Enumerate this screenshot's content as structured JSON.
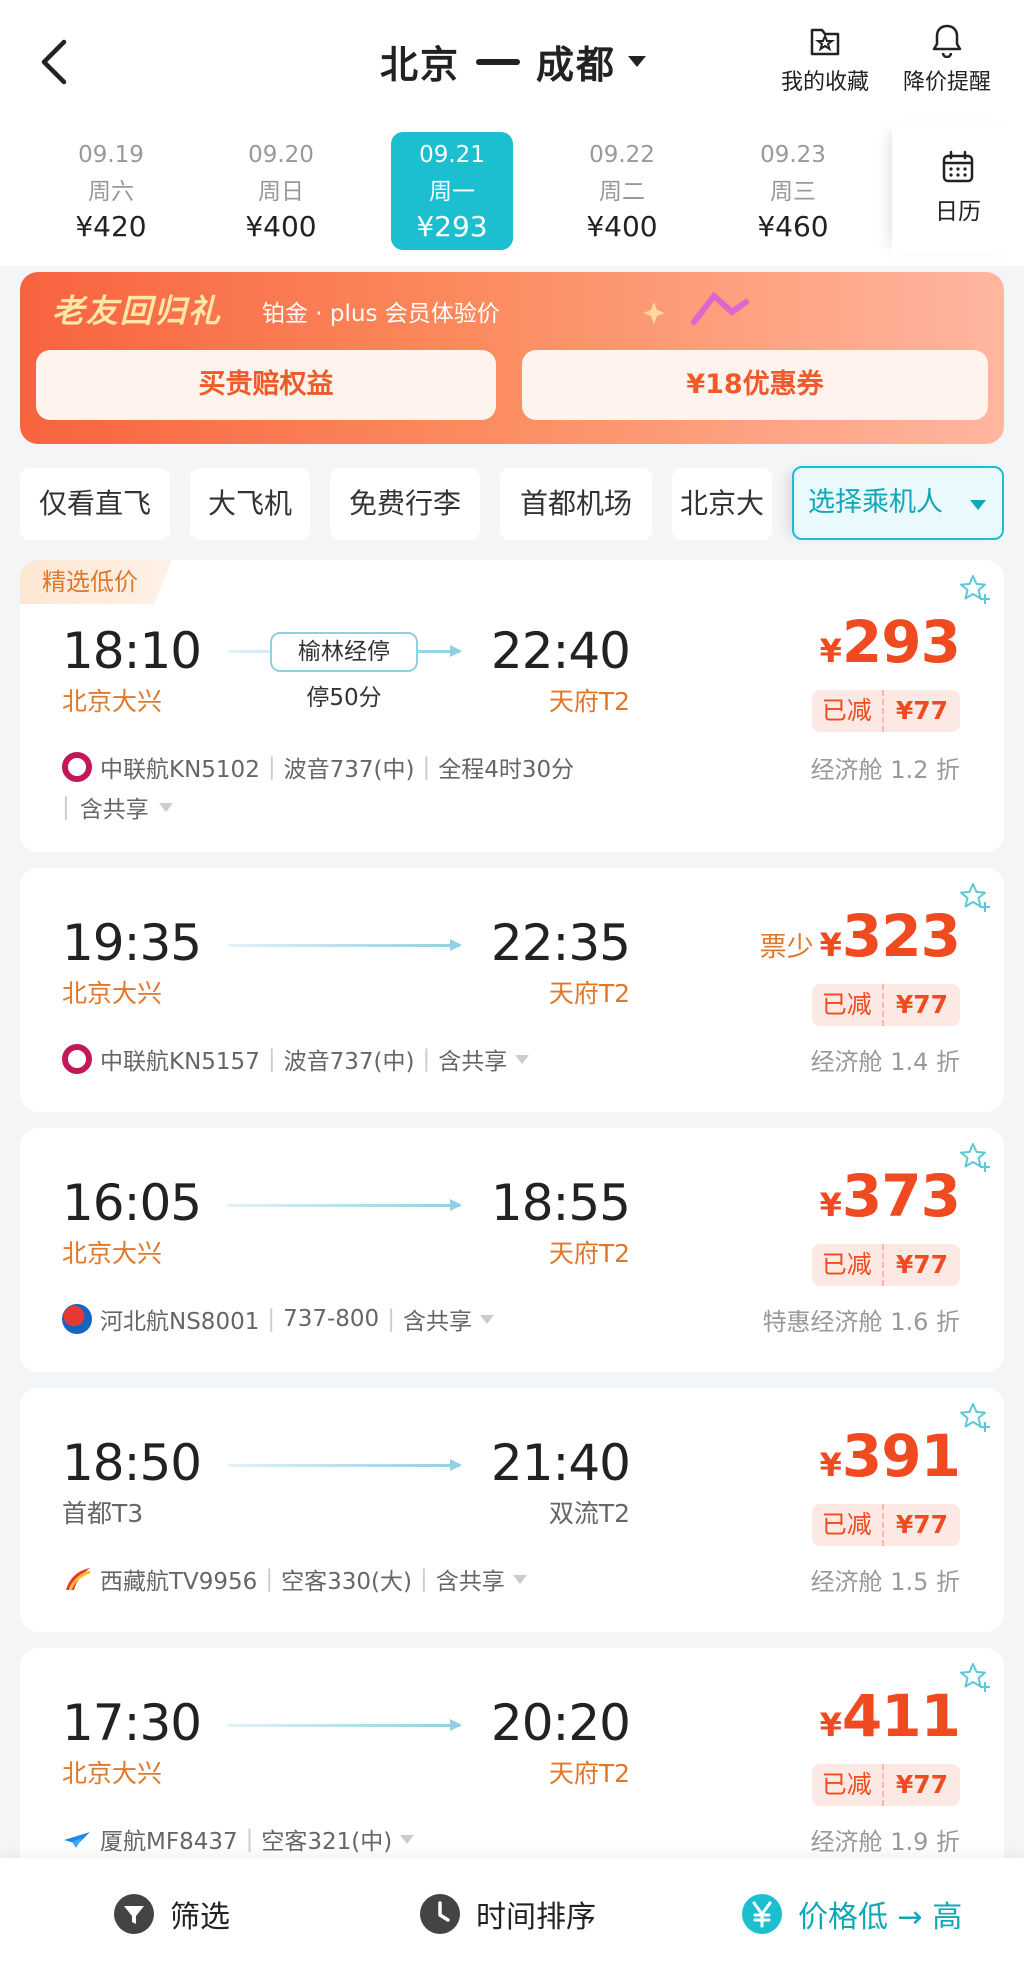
{
  "header": {
    "from": "北京",
    "to": "成都",
    "favorites_label": "我的收藏",
    "price_alert_label": "降价提醒"
  },
  "dates": [
    {
      "date": "09.19",
      "weekday": "周六",
      "price": "¥420",
      "active": false
    },
    {
      "date": "09.20",
      "weekday": "周日",
      "price": "¥400",
      "active": false
    },
    {
      "date": "09.21",
      "weekday": "周一",
      "price": "¥293",
      "active": true
    },
    {
      "date": "09.22",
      "weekday": "周二",
      "price": "¥400",
      "active": false
    },
    {
      "date": "09.23",
      "weekday": "周三",
      "price": "¥460",
      "active": false
    }
  ],
  "calendar_label": "日历",
  "promo": {
    "tag": "老友回归礼",
    "subtitle": "铂金 · plus 会员体验价",
    "btn_left": "买贵赔权益",
    "btn_right": "¥18优惠券"
  },
  "filters": [
    "仅看直飞",
    "大飞机",
    "免费行李",
    "首都机场",
    "北京大"
  ],
  "passenger_select": "选择乘机人",
  "flights": [
    {
      "badge": "精选低价",
      "dep_time": "18:10",
      "dep_airport": "北京大兴",
      "arr_time": "22:40",
      "arr_airport": "天府T2",
      "stop": "榆林经停",
      "stop_duration": "停50分",
      "price_prefix": "",
      "yen": "¥",
      "price": "293",
      "discount_label": "已减",
      "discount_value": "¥77",
      "cabin": "经济舱 1.2 折",
      "airline": "中联航KN5102",
      "aircraft": "波音737(中)",
      "duration": "全程4时30分",
      "share": "含共享"
    },
    {
      "dep_time": "19:35",
      "dep_airport": "北京大兴",
      "arr_time": "22:35",
      "arr_airport": "天府T2",
      "price_prefix": "票少",
      "yen": "¥",
      "price": "323",
      "discount_label": "已减",
      "discount_value": "¥77",
      "cabin": "经济舱 1.4 折",
      "airline": "中联航KN5157",
      "aircraft": "波音737(中)",
      "share": "含共享"
    },
    {
      "dep_time": "16:05",
      "dep_airport": "北京大兴",
      "arr_time": "18:55",
      "arr_airport": "天府T2",
      "price_prefix": "",
      "yen": "¥",
      "price": "373",
      "discount_label": "已减",
      "discount_value": "¥77",
      "cabin": "特惠经济舱 1.6 折",
      "airline": "河北航NS8001",
      "aircraft": "737-800",
      "share": "含共享"
    },
    {
      "dep_time": "18:50",
      "dep_airport": "首都T3",
      "arr_time": "21:40",
      "arr_airport": "双流T2",
      "price_prefix": "",
      "yen": "¥",
      "price": "391",
      "discount_label": "已减",
      "discount_value": "¥77",
      "cabin": "经济舱 1.5 折",
      "airline": "西藏航TV9956",
      "aircraft": "空客330(大)",
      "share": "含共享"
    },
    {
      "dep_time": "17:30",
      "dep_airport": "北京大兴",
      "arr_time": "20:20",
      "arr_airport": "天府T2",
      "price_prefix": "",
      "yen": "¥",
      "price": "411",
      "discount_label": "已减",
      "discount_value": "¥77",
      "cabin": "经济舱 1.9 折",
      "airline": "厦航MF8437",
      "aircraft": "空客321(中)"
    }
  ],
  "bottom_bar": {
    "filter": "筛选",
    "time_sort": "时间排序",
    "price_sort": "价格低 → 高"
  },
  "colors": {
    "accent": "#1bbfd0",
    "price": "#f04a21",
    "airport_highlight": "#e0782c"
  }
}
